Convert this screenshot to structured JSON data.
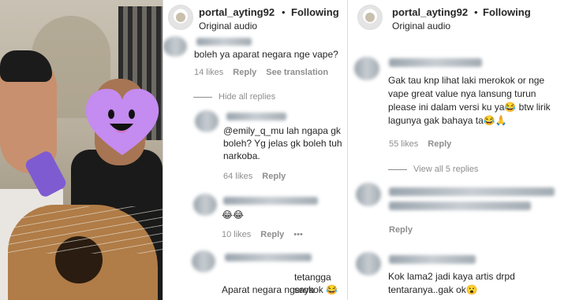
{
  "panel_mid": {
    "header": {
      "username": "portal_ayting92",
      "separator": "•",
      "follow_status": "Following",
      "audio_label": "Original audio"
    },
    "comments": [
      {
        "text": "boleh ya aparat negara nge vape?",
        "likes": "14 likes",
        "reply": "Reply",
        "translation": "See translation"
      }
    ],
    "hide_replies": "Hide all replies",
    "replies": [
      {
        "text": "@emily_q_mu lah ngapa gk boleh? Yg jelas gk boleh tuh narkoba.",
        "likes": "64 likes",
        "reply": "Reply"
      },
      {
        "text": "😂😂",
        "likes": "10 likes",
        "reply": "Reply",
        "more": "•••"
      },
      {
        "text_a": "tetangga saya",
        "text_b": "Aparat negara ngerokok 😂"
      }
    ]
  },
  "panel_right": {
    "header": {
      "username": "portal_ayting92",
      "separator": "•",
      "follow_status": "Following",
      "audio_label": "Original audio"
    },
    "comments": [
      {
        "text": "Gak tau knp lihat laki merokok or nge vape great value nya lansung turun please ini dalam versi ku ya😂 btw lirik lagunya gak bahaya ta😂🙏",
        "likes": "55 likes",
        "reply": "Reply"
      }
    ],
    "view_replies": "View all 5 replies",
    "reply_only": "Reply",
    "last_comment": "Kok lama2 jadi kaya artis drpd tentaranya..gak ok😮"
  },
  "colors": {
    "text": "#262626",
    "meta": "#8e8e8e",
    "heart_emoji": "#c48bf0",
    "divider": "#dbdbdb"
  },
  "icons": {
    "heart": "heart-face-sticker",
    "avatar": "profile-avatar"
  }
}
